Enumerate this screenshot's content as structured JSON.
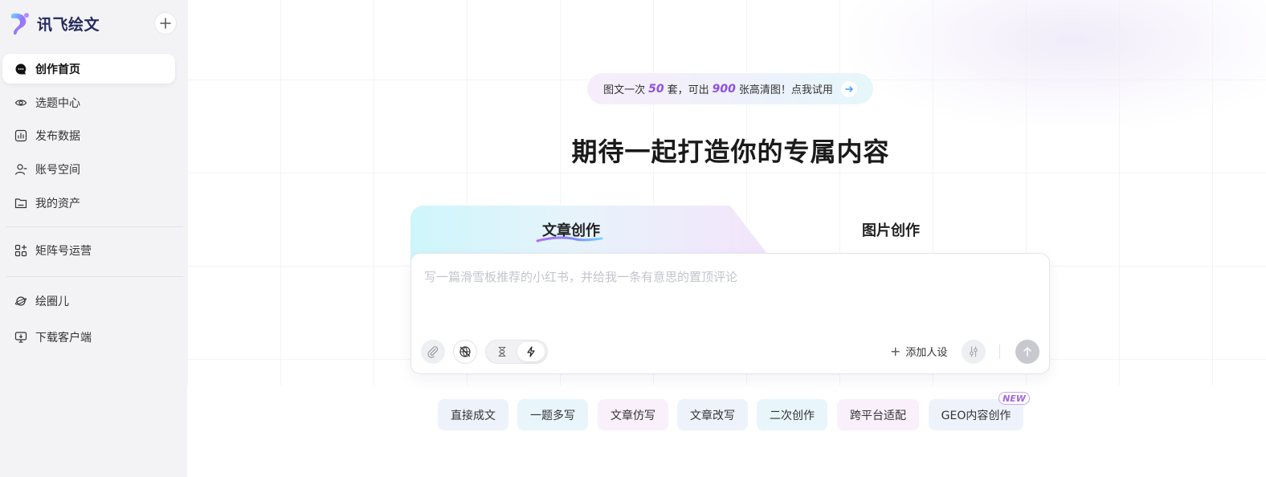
{
  "app": {
    "brand_name": "讯飞绘文"
  },
  "sidebar": {
    "items": [
      {
        "label": "创作首页"
      },
      {
        "label": "选题中心"
      },
      {
        "label": "发布数据"
      },
      {
        "label": "账号空间"
      },
      {
        "label": "我的资产"
      },
      {
        "label": "矩阵号运营"
      },
      {
        "label": "绘圈儿"
      },
      {
        "label": "下载客户端"
      }
    ],
    "active_index": 0
  },
  "promo": {
    "part1": "图文一次",
    "num1": "50",
    "part2": "套，可出",
    "num2": "900",
    "part3": "张高清图！点我试用"
  },
  "headline": "期待一起打造你的专属内容",
  "tabs": [
    {
      "label": "文章创作",
      "active": true
    },
    {
      "label": "图片创作",
      "active": false
    }
  ],
  "composer": {
    "placeholder": "写一篇滑雪板推荐的小红书，并给我一条有意思的置顶评论",
    "value": "",
    "add_persona_label": "添加人设"
  },
  "chips": [
    {
      "label": "直接成文"
    },
    {
      "label": "一题多写"
    },
    {
      "label": "文章仿写"
    },
    {
      "label": "文章改写"
    },
    {
      "label": "二次创作"
    },
    {
      "label": "跨平台适配"
    },
    {
      "label": "GEO内容创作",
      "badge": "NEW"
    }
  ],
  "colors": {
    "brand": "#24285e",
    "accent": "#8f4fe3",
    "sidebar_bg": "#f3f3f6"
  }
}
